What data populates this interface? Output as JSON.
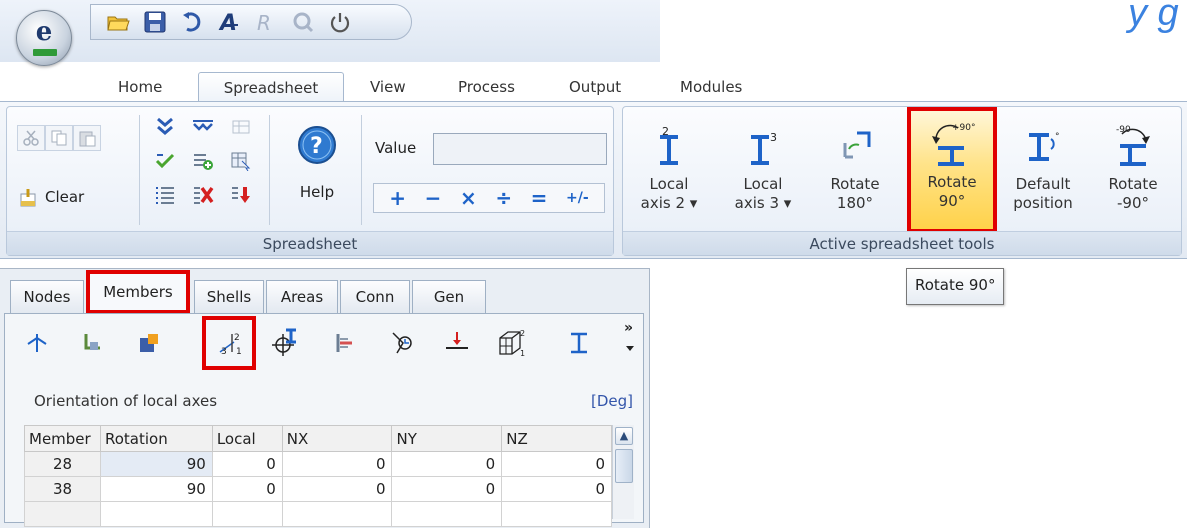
{
  "app": {
    "logo_letter": "e",
    "top_right_text": "y g"
  },
  "quick_access": [
    "open-folder-icon",
    "save-icon",
    "undo-icon",
    "text-a-icon",
    "report-icon",
    "preview-icon",
    "power-icon"
  ],
  "ribbon_tabs": [
    "Home",
    "Spreadsheet",
    "View",
    "Process",
    "Output",
    "Modules"
  ],
  "spreadsheet_group": {
    "clear_label": "Clear",
    "help_label": "Help",
    "value_label": "Value",
    "value_input": "",
    "group_label": "Spreadsheet",
    "operators": [
      "+",
      "−",
      "×",
      "÷",
      "=",
      "+/-"
    ]
  },
  "active_tools_group": {
    "group_label": "Active spreadsheet tools",
    "tools": [
      {
        "line1": "Local",
        "line2": "axis 2 ▾"
      },
      {
        "line1": "Local",
        "line2": "axis 3 ▾"
      },
      {
        "line1": "Rotate",
        "line2": "180°"
      },
      {
        "line1": "Rotate",
        "line2": "90°"
      },
      {
        "line1": "Default",
        "line2": "position"
      },
      {
        "line1": "Rotate",
        "line2": "-90°"
      }
    ],
    "icon_labels": {
      "rotate90": "+90°",
      "rotate_neg90": "-90"
    }
  },
  "tooltip": "Rotate 90°",
  "panel_tabs": [
    "Nodes",
    "Members",
    "Shells",
    "Areas",
    "Conn",
    "Gen"
  ],
  "panel": {
    "subtitle": "Orientation of local axes",
    "unit": "[Deg]",
    "overflow": "»"
  },
  "table": {
    "headers": [
      "Member",
      "Rotation",
      "Local",
      "NX",
      "NY",
      "NZ"
    ],
    "rows": [
      [
        "28",
        "90",
        "0",
        "0",
        "0",
        "0"
      ],
      [
        "38",
        "90",
        "0",
        "0",
        "0",
        "0"
      ]
    ]
  },
  "colors": {
    "highlight_red": "#e00000",
    "accent_blue": "#1e63c8",
    "ribbon_bg": "#e3eaf3"
  }
}
